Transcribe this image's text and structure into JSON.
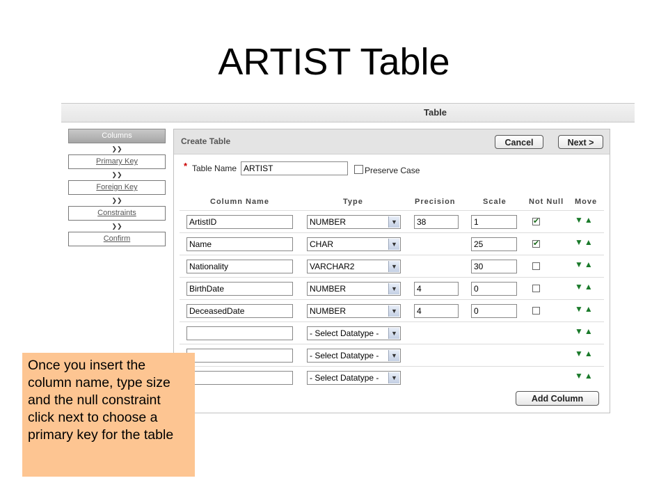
{
  "slide": {
    "title": "ARTIST Table"
  },
  "topbar": {
    "label": "Table"
  },
  "steps": [
    {
      "label": "Columns",
      "active": true
    },
    {
      "label": "Primary Key",
      "active": false
    },
    {
      "label": "Foreign Key",
      "active": false
    },
    {
      "label": "Constraints",
      "active": false
    },
    {
      "label": "Confirm",
      "active": false
    }
  ],
  "panel": {
    "title": "Create Table",
    "cancel_label": "Cancel",
    "next_label": "Next >",
    "table_name_label": "Table Name",
    "table_name_value": "ARTIST",
    "preserve_case_label": "Preserve Case",
    "add_column_label": "Add Column"
  },
  "columns_header": {
    "name": "Column Name",
    "type": "Type",
    "precision": "Precision",
    "scale": "Scale",
    "not_null": "Not Null",
    "move": "Move"
  },
  "rows": [
    {
      "name": "ArtistID",
      "type": "NUMBER",
      "precision": "38",
      "scale": "1",
      "not_null": true
    },
    {
      "name": "Name",
      "type": "CHAR",
      "precision": "",
      "scale": "25",
      "not_null": true
    },
    {
      "name": "Nationality",
      "type": "VARCHAR2",
      "precision": "",
      "scale": "30",
      "not_null": false
    },
    {
      "name": "BirthDate",
      "type": "NUMBER",
      "precision": "4",
      "scale": "0",
      "not_null": false
    },
    {
      "name": "DeceasedDate",
      "type": "NUMBER",
      "precision": "4",
      "scale": "0",
      "not_null": false
    },
    {
      "name": "",
      "type": "- Select Datatype -",
      "precision": null,
      "scale": null,
      "not_null": null
    },
    {
      "name": "",
      "type": "- Select Datatype -",
      "precision": null,
      "scale": null,
      "not_null": null
    },
    {
      "name": "",
      "type": "- Select Datatype -",
      "precision": null,
      "scale": null,
      "not_null": null
    }
  ],
  "move_glyph": "▼▲",
  "callout": {
    "text": "Once you insert the column name, type size and the null constraint click next to choose a primary key for the table"
  },
  "icons": {
    "step_arrow": "chevron-down-icon",
    "required": "asterisk-icon",
    "select_arrow": "chevron-down-icon",
    "move": "move-arrows-icon"
  },
  "colors": {
    "callout_bg": "#fdc592",
    "move_arrows": "#1a7a2a",
    "required_star": "#cc0000"
  }
}
